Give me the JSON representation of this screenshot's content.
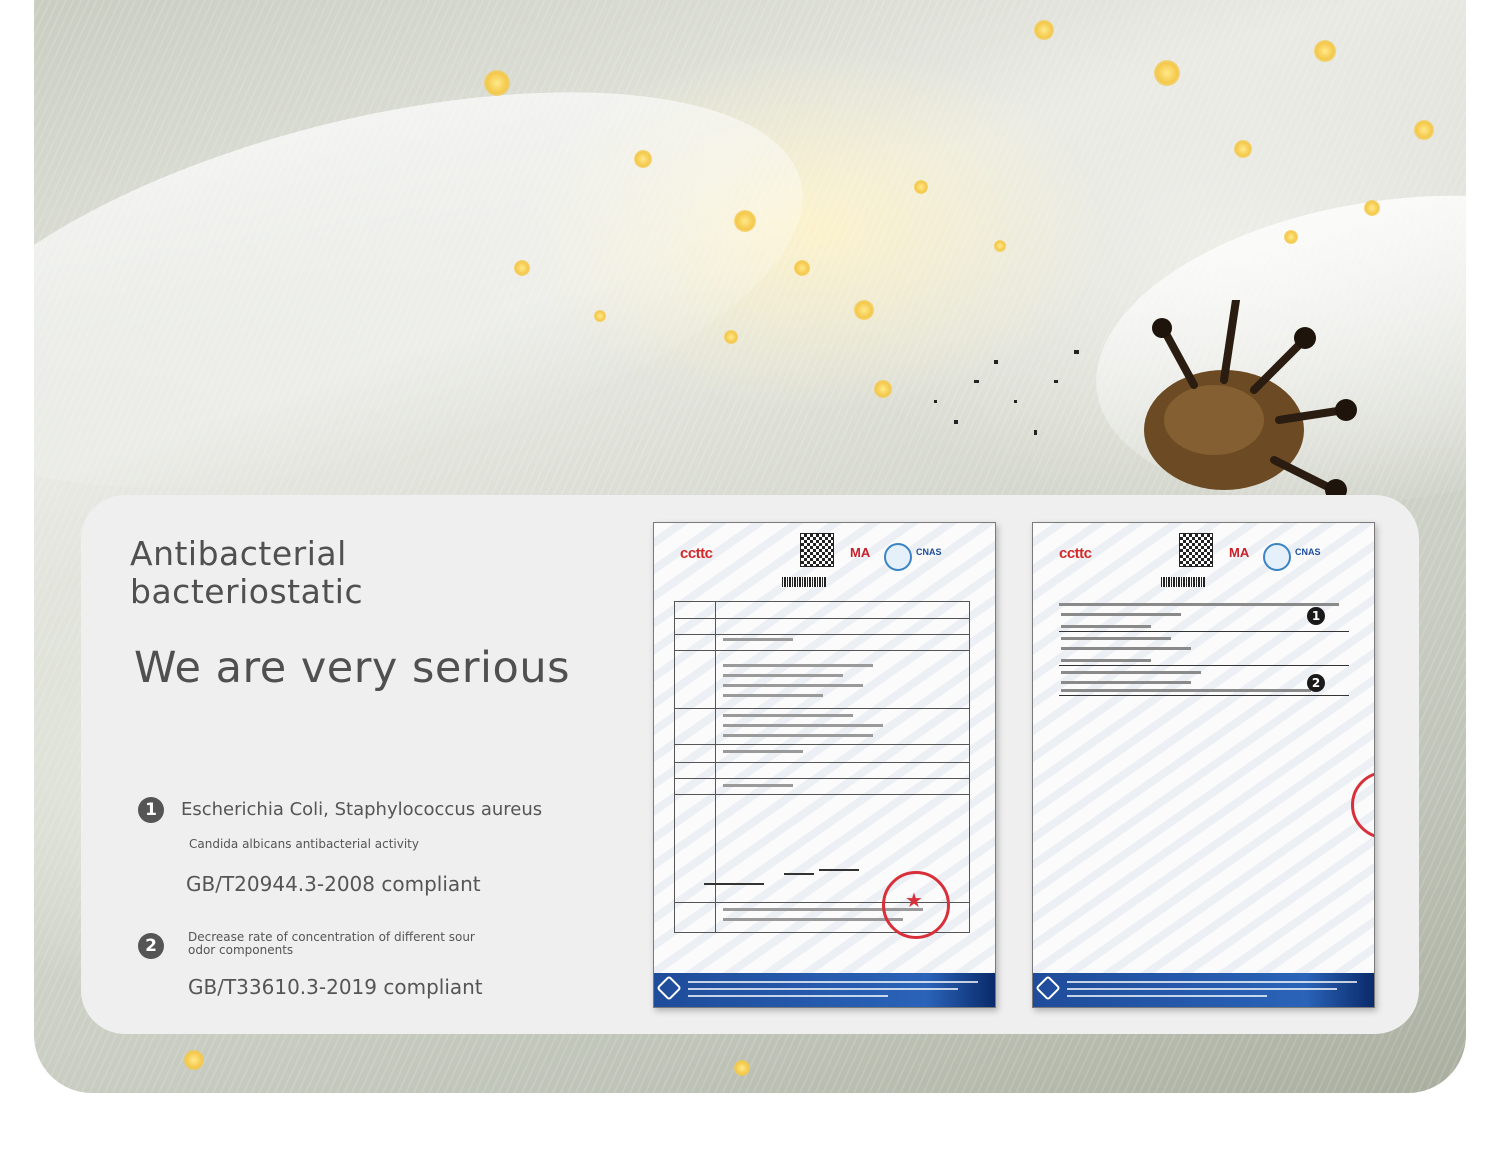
{
  "panel": {
    "title": "Antibacterial bacteriostatic",
    "slogan": "We are very serious"
  },
  "items": [
    {
      "number": "1",
      "heading": "Escherichia Coli, Staphylococcus aureus",
      "detail": "Candida albicans antibacterial activity",
      "compliance": "GB/T20944.3-2008 compliant"
    },
    {
      "number": "2",
      "detail": "Decrease rate of concentration of different sour odor components",
      "compliance": "GB/T33610.3-2019 compliant"
    }
  ],
  "documents": [
    {
      "logo": "cttc",
      "badges": []
    },
    {
      "logo": "cttc",
      "badges": [
        "1",
        "2"
      ]
    }
  ],
  "icons": {
    "item_1": "number-one-badge-icon",
    "item_2": "number-two-badge-icon",
    "seal": "red-seal-stamp-icon",
    "qr": "qr-code-icon"
  },
  "colors": {
    "panel_bg": "#efefef",
    "text": "#555555",
    "badge": "#555555",
    "footer_blue": "#1f4c9a",
    "seal_red": "#d8303a"
  }
}
